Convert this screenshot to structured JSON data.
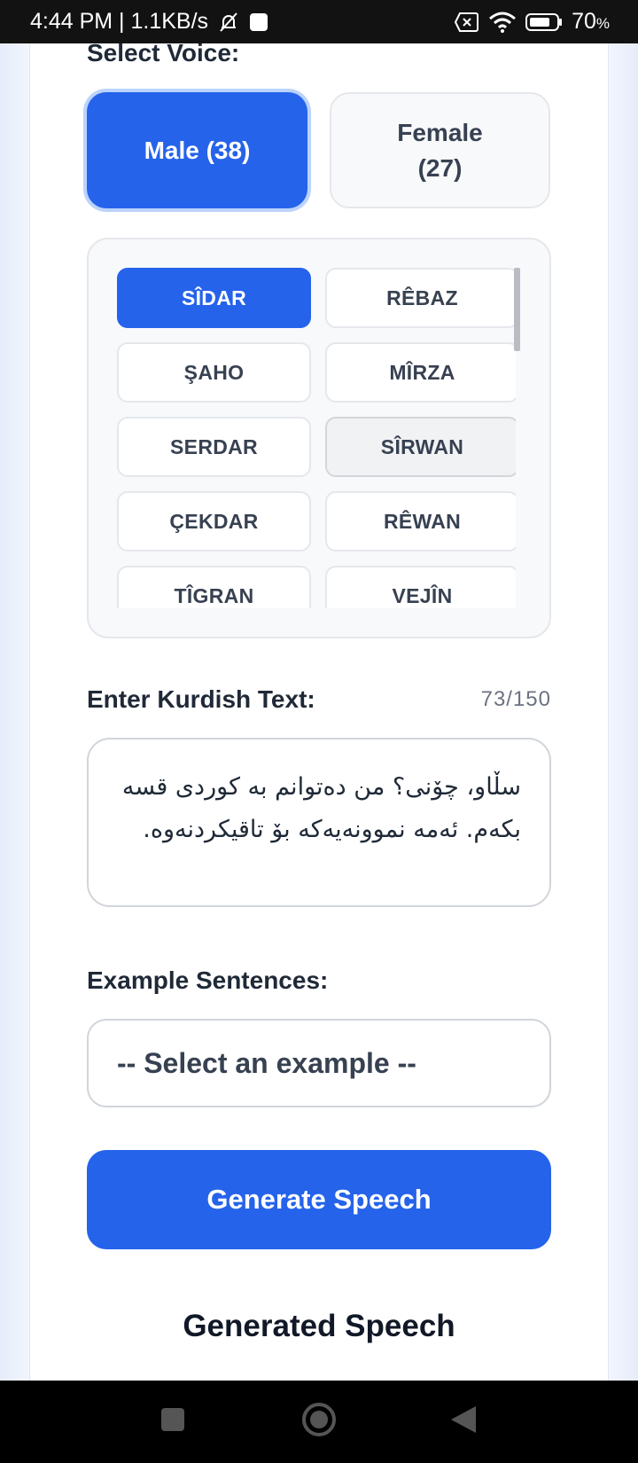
{
  "status_bar": {
    "time_speed": "4:44 PM | 1.1KB/s",
    "battery_percent": "70",
    "battery_unit": "%"
  },
  "voice": {
    "select_label": "Select Voice:",
    "male_label": "Male (38)",
    "female_line1": "Female",
    "female_line2": "(27)",
    "selected_gender": "male",
    "voices": [
      "SÎDAR",
      "RÊBAZ",
      "ŞAHO",
      "MÎRZA",
      "SERDAR",
      "SÎRWAN",
      "ÇEKDAR",
      "RÊWAN",
      "TÎGRAN",
      "VEJÎN"
    ],
    "selected_voice": "SÎDAR",
    "hover_voice": "SÎRWAN"
  },
  "text_input": {
    "label": "Enter Kurdish Text:",
    "count": "73/150",
    "value": "سڵاو، چۆنی؟ من دەتوانم بە کوردی قسە بکەم. ئەمە نموونەیەکە بۆ تاقیکردنەوە."
  },
  "examples": {
    "label": "Example Sentences:",
    "selected": "-- Select an example --"
  },
  "actions": {
    "generate_label": "Generate Speech"
  },
  "output": {
    "title": "Generated Speech"
  },
  "colors": {
    "accent": "#2563eb",
    "status_bar": "#121212",
    "nav_bar": "#000000"
  }
}
